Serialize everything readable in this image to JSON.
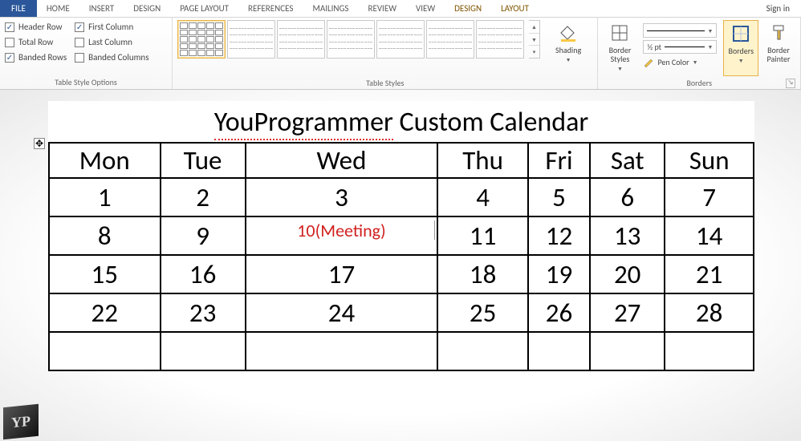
{
  "tabs": {
    "file": "FILE",
    "items": [
      "HOME",
      "INSERT",
      "DESIGN",
      "PAGE LAYOUT",
      "REFERENCES",
      "MAILINGS",
      "REVIEW",
      "VIEW"
    ],
    "tools": [
      "DESIGN",
      "LAYOUT"
    ],
    "signin": "Sign in"
  },
  "ribbon": {
    "tso": {
      "label": "Table Style Options",
      "header_row": "Header Row",
      "total_row": "Total Row",
      "banded_rows": "Banded Rows",
      "first_col": "First Column",
      "last_col": "Last Column",
      "banded_cols": "Banded Columns",
      "checked": {
        "header_row": true,
        "total_row": false,
        "banded_rows": true,
        "first_col": true,
        "last_col": false,
        "banded_cols": false
      }
    },
    "styles": {
      "label": "Table Styles",
      "shading": "Shading"
    },
    "borders": {
      "label": "Borders",
      "border_styles": "Border\nStyles",
      "pen_width": "½ pt",
      "pen_color": "Pen Color",
      "borders_btn": "Borders",
      "painter": "Border\nPainter"
    }
  },
  "doc": {
    "title_err": "YouProgrammer",
    "title_rest": " Custom Calendar",
    "days": [
      "Mon",
      "Tue",
      "Wed",
      "Thu",
      "Fri",
      "Sat",
      "Sun"
    ],
    "rows": [
      [
        "1",
        "2",
        "3",
        "4",
        "5",
        "6",
        "7"
      ],
      [
        "8",
        "9",
        "10(Meeting)",
        "11",
        "12",
        "13",
        "14"
      ],
      [
        "15",
        "16",
        "17",
        "18",
        "19",
        "20",
        "21"
      ],
      [
        "22",
        "23",
        "24",
        "25",
        "26",
        "27",
        "28"
      ],
      [
        "",
        "",
        "",
        "",
        "",
        "",
        ""
      ]
    ],
    "meeting_cell": {
      "row": 1,
      "col": 2
    }
  },
  "logo": "YP"
}
